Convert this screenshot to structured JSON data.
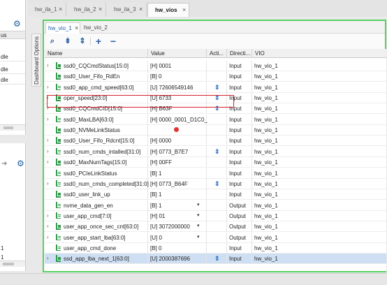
{
  "left_panel_top": {
    "header": "us",
    "rows": [
      "dle",
      "dle",
      "dle"
    ]
  },
  "left_panel_bottom": {
    "rows": [
      "1",
      "1"
    ]
  },
  "top_tabs": [
    {
      "label": "hw_ila_1"
    },
    {
      "label": "hw_ila_2"
    },
    {
      "label": "hw_ila_3"
    },
    {
      "label": "hw_vios"
    }
  ],
  "dashboard_options": "Dashboard Options",
  "sub_tabs": [
    {
      "label": "hw_vio_1"
    },
    {
      "label": "hw_vio_2"
    }
  ],
  "columns": [
    "Name",
    "Value",
    "Acti...",
    "Directi...",
    "VIO"
  ],
  "rows": [
    {
      "name": "ssd0_CQCmdStatus[15:0]",
      "value": "[H] 0001",
      "activity": "",
      "direction": "Input",
      "vio": "hw_vio_1",
      "expand": true,
      "dropdown": false
    },
    {
      "name": "ssd0_User_Fifo_RdEn",
      "value": "[B] 0",
      "activity": "",
      "direction": "Input",
      "vio": "hw_vio_1",
      "expand": false,
      "dropdown": false
    },
    {
      "name": "ssd0_app_cmd_speed[63:0]",
      "value": "[U] 72606549146",
      "activity": "arrow",
      "direction": "Input",
      "vio": "hw_vio_1",
      "expand": true,
      "dropdown": false
    },
    {
      "name": "oper_speed[23:0]",
      "value": "[U] 6733",
      "activity": "arrow",
      "direction": "Input",
      "vio": "hw_vio_1",
      "expand": true,
      "dropdown": false
    },
    {
      "name": "ssd0_CQCmdCID[15:0]",
      "value": "[H] B63F",
      "activity": "arrow",
      "direction": "Input",
      "vio": "hw_vio_1",
      "expand": true,
      "dropdown": false
    },
    {
      "name": "ssd0_MaxLBA[63:0]",
      "value": "[H] 0000_0001_D1C0_",
      "activity": "",
      "direction": "Input",
      "vio": "hw_vio_1",
      "expand": true,
      "dropdown": false
    },
    {
      "name": "ssd0_NVMeLinkStatus",
      "value": "",
      "activity": "dot",
      "direction": "Input",
      "vio": "hw_vio_1",
      "expand": false,
      "dropdown": false
    },
    {
      "name": "ssd0_User_Fifo_Rdcnt[15:0]",
      "value": "[H] 0000",
      "activity": "",
      "direction": "Input",
      "vio": "hw_vio_1",
      "expand": true,
      "dropdown": false
    },
    {
      "name": "ssd0_num_cmds_intalled[31:0]",
      "value": "[H] 0773_B7E7",
      "activity": "arrow",
      "direction": "Input",
      "vio": "hw_vio_1",
      "expand": true,
      "dropdown": false
    },
    {
      "name": "ssd0_MaxNumTags[15:0]",
      "value": "[H] 00FF",
      "activity": "",
      "direction": "Input",
      "vio": "hw_vio_1",
      "expand": true,
      "dropdown": false
    },
    {
      "name": "ssd0_PCIeLinkStatus",
      "value": "[B] 1",
      "activity": "",
      "direction": "Input",
      "vio": "hw_vio_1",
      "expand": false,
      "dropdown": false
    },
    {
      "name": "ssd0_num_cmds_completed[31:0]",
      "value": "[H] 0773_B64F",
      "activity": "arrow",
      "direction": "Input",
      "vio": "hw_vio_1",
      "expand": true,
      "dropdown": false
    },
    {
      "name": "ssd0_user_link_up",
      "value": "[B] 1",
      "activity": "",
      "direction": "Input",
      "vio": "hw_vio_1",
      "expand": false,
      "dropdown": false
    },
    {
      "name": "nvme_data_gen_en",
      "value": "[B] 1",
      "activity": "",
      "direction": "Output",
      "vio": "hw_vio_1",
      "expand": false,
      "dropdown": true
    },
    {
      "name": "user_app_cmd[7:0]",
      "value": "[H] 01",
      "activity": "",
      "direction": "Output",
      "vio": "hw_vio_1",
      "expand": true,
      "dropdown": true
    },
    {
      "name": "user_app_once_sec_cnt[63:0]",
      "value": "[U] 3072000000",
      "activity": "",
      "direction": "Output",
      "vio": "hw_vio_1",
      "expand": true,
      "dropdown": true
    },
    {
      "name": "user_app_start_lba[63:0]",
      "value": "[U] 0",
      "activity": "",
      "direction": "Output",
      "vio": "hw_vio_1",
      "expand": true,
      "dropdown": true
    },
    {
      "name": "user_app_cmd_done",
      "value": "[B] 0",
      "activity": "",
      "direction": "Input",
      "vio": "hw_vio_1",
      "expand": false,
      "dropdown": false
    },
    {
      "name": "ssd_app_lba_next_1[63:0]",
      "value": "[U] 2000387696",
      "activity": "arrow",
      "direction": "Input",
      "vio": "hw_vio_1",
      "expand": true,
      "dropdown": false
    }
  ],
  "colors": {
    "panel_border": "#58d060",
    "highlight_box": "#d4232e",
    "selected_row": "#cfdff3",
    "accent": "#2b5f9e",
    "signal_icon": "#2f9a4a"
  }
}
